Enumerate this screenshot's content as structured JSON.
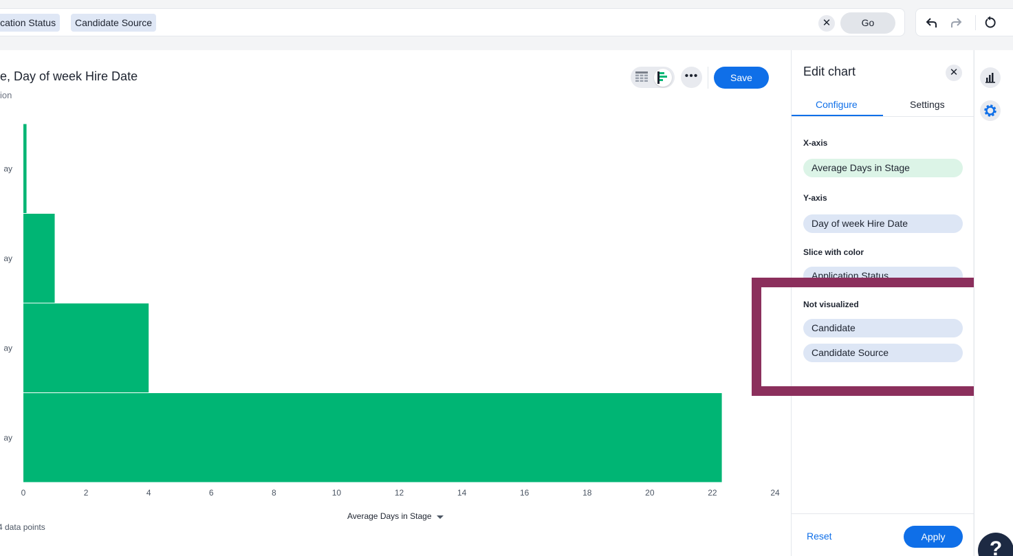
{
  "search": {
    "tokens": [
      "Application Status",
      "Candidate Source"
    ],
    "go_label": "Go"
  },
  "chart_header": {
    "title": "e, Day of week Hire Date",
    "subtitle": "ion",
    "save_label": "Save"
  },
  "chart_data": {
    "type": "bar",
    "orientation": "horizontal",
    "categories": [
      "ay",
      "ay",
      "ay",
      "ay"
    ],
    "values": [
      0.1,
      1,
      4,
      22.3
    ],
    "xlabel": "Average Days in Stage",
    "xlim": [
      0,
      24
    ],
    "xticks": [
      0,
      2,
      4,
      6,
      8,
      10,
      12,
      14,
      16,
      18,
      20,
      22,
      24
    ],
    "color": "#00b574",
    "grid": false
  },
  "footnote": "4 data points",
  "edit_panel": {
    "title": "Edit chart",
    "tabs": [
      "Configure",
      "Settings"
    ],
    "active_tab": "Configure",
    "sections": {
      "x_axis": {
        "label": "X-axis",
        "value": "Average Days in Stage"
      },
      "y_axis": {
        "label": "Y-axis",
        "value": "Day of week Hire Date"
      },
      "slice": {
        "label": "Slice with color",
        "value": "Application Status"
      },
      "not_visualized": {
        "label": "Not visualized",
        "values": [
          "Candidate",
          "Candidate Source"
        ]
      }
    },
    "reset_label": "Reset",
    "apply_label": "Apply"
  },
  "help_label": "?",
  "colors": {
    "accent": "#0f6fe8",
    "bar": "#00b574",
    "highlight": "#8b2f5c"
  },
  "icons": [
    "close-icon",
    "undo-icon",
    "redo-icon",
    "reset-icon",
    "table-view-icon",
    "bar-chart-view-icon",
    "more-icon",
    "chart-rail-icon",
    "gear-icon",
    "help-icon"
  ]
}
